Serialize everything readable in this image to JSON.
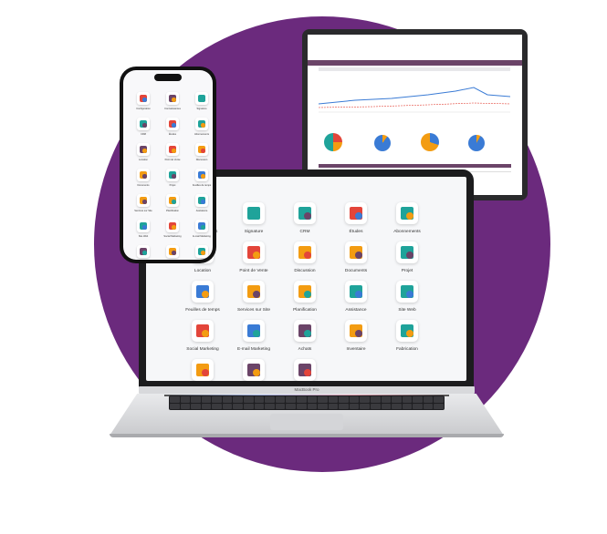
{
  "laptop": {
    "model_label": "MacBook Pro",
    "apps": [
      {
        "label": "Connaissances",
        "icon": "bookmark-icon"
      },
      {
        "label": "Signature",
        "icon": "signature-icon"
      },
      {
        "label": "CRM",
        "icon": "crm-icon"
      },
      {
        "label": "Études",
        "icon": "tools-icon"
      },
      {
        "label": "Abonnements",
        "icon": "refresh-icon"
      },
      {
        "label": "Location",
        "icon": "location-icon"
      },
      {
        "label": "Point de Vente",
        "icon": "shop-icon"
      },
      {
        "label": "Discussion",
        "icon": "chat-icon"
      },
      {
        "label": "Documents",
        "icon": "documents-icon"
      },
      {
        "label": "Projet",
        "icon": "project-icon"
      },
      {
        "label": "Feuilles de temps",
        "icon": "timesheet-icon"
      },
      {
        "label": "Services sur Site",
        "icon": "bolt-icon"
      },
      {
        "label": "Planification",
        "icon": "planning-icon"
      },
      {
        "label": "Assistance",
        "icon": "helpdesk-icon"
      },
      {
        "label": "Site Web",
        "icon": "website-icon"
      },
      {
        "label": "Social Marketing",
        "icon": "heart-icon"
      },
      {
        "label": "E-mail Marketing",
        "icon": "paper-plane-icon"
      },
      {
        "label": "Achats",
        "icon": "purchase-icon"
      },
      {
        "label": "Inventaire",
        "icon": "box-icon"
      },
      {
        "label": "Fabrication",
        "icon": "factory-icon"
      },
      {
        "label": "Ventes",
        "icon": "sales-chart-icon"
      },
      {
        "label": "RH",
        "icon": "employees-icon"
      },
      {
        "label": "Tableau de bord",
        "icon": "dashboard-icon"
      }
    ]
  },
  "phone": {
    "apps": [
      {
        "label": "Configuration",
        "icon": "tools-icon"
      },
      {
        "label": "Connaissances",
        "icon": "bookmark-icon"
      },
      {
        "label": "Signature",
        "icon": "signature-icon"
      },
      {
        "label": "CRM",
        "icon": "crm-icon"
      },
      {
        "label": "Études",
        "icon": "tools-icon"
      },
      {
        "label": "Abonnements",
        "icon": "refresh-icon"
      },
      {
        "label": "Location",
        "icon": "location-icon"
      },
      {
        "label": "Point de Vente",
        "icon": "shop-icon"
      },
      {
        "label": "Discussion",
        "icon": "chat-icon"
      },
      {
        "label": "Documents",
        "icon": "documents-icon"
      },
      {
        "label": "Projet",
        "icon": "project-icon"
      },
      {
        "label": "Feuilles de temps",
        "icon": "timesheet-icon"
      },
      {
        "label": "Services sur Site",
        "icon": "bolt-icon"
      },
      {
        "label": "Planification",
        "icon": "planning-icon"
      },
      {
        "label": "Assistance",
        "icon": "helpdesk-icon"
      },
      {
        "label": "Site Web",
        "icon": "website-icon"
      },
      {
        "label": "Social Marketing",
        "icon": "heart-icon"
      },
      {
        "label": "E-mail Marketing",
        "icon": "paper-plane-icon"
      },
      {
        "label": "Achats",
        "icon": "purchase-icon"
      },
      {
        "label": "Inventaire",
        "icon": "box-icon"
      },
      {
        "label": "Fabrication",
        "icon": "factory-icon"
      }
    ]
  },
  "colors": {
    "brand_purple": "#6b2a7d",
    "tablet_nav": "#6b4468",
    "teal": "#1fa39a",
    "orange": "#f39c12",
    "blue": "#3a7bd5",
    "red": "#e3453a"
  }
}
